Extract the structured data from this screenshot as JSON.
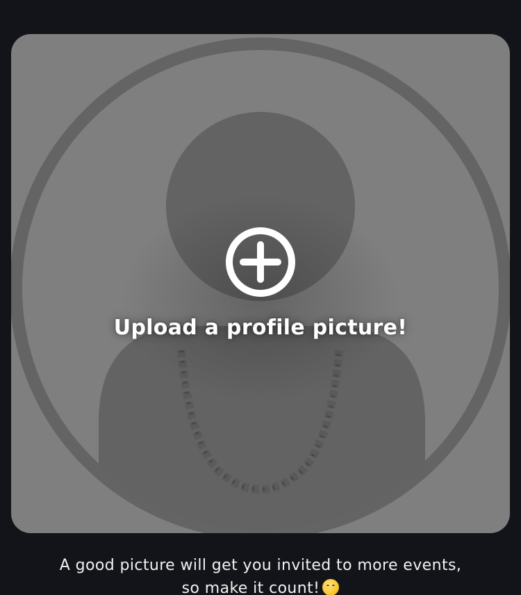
{
  "upload": {
    "label": "Upload a profile picture!",
    "action_icon": "plus-circle-icon",
    "placeholder_icon": "default-avatar-icon"
  },
  "hint": {
    "line1": "A good picture will get you invited to more events,",
    "line2": "so make it count!",
    "emoji": "😋"
  },
  "colors": {
    "background": "#131419",
    "card": "#7f7f7f",
    "avatar_shape": "#636363",
    "text": "#ffffff"
  }
}
